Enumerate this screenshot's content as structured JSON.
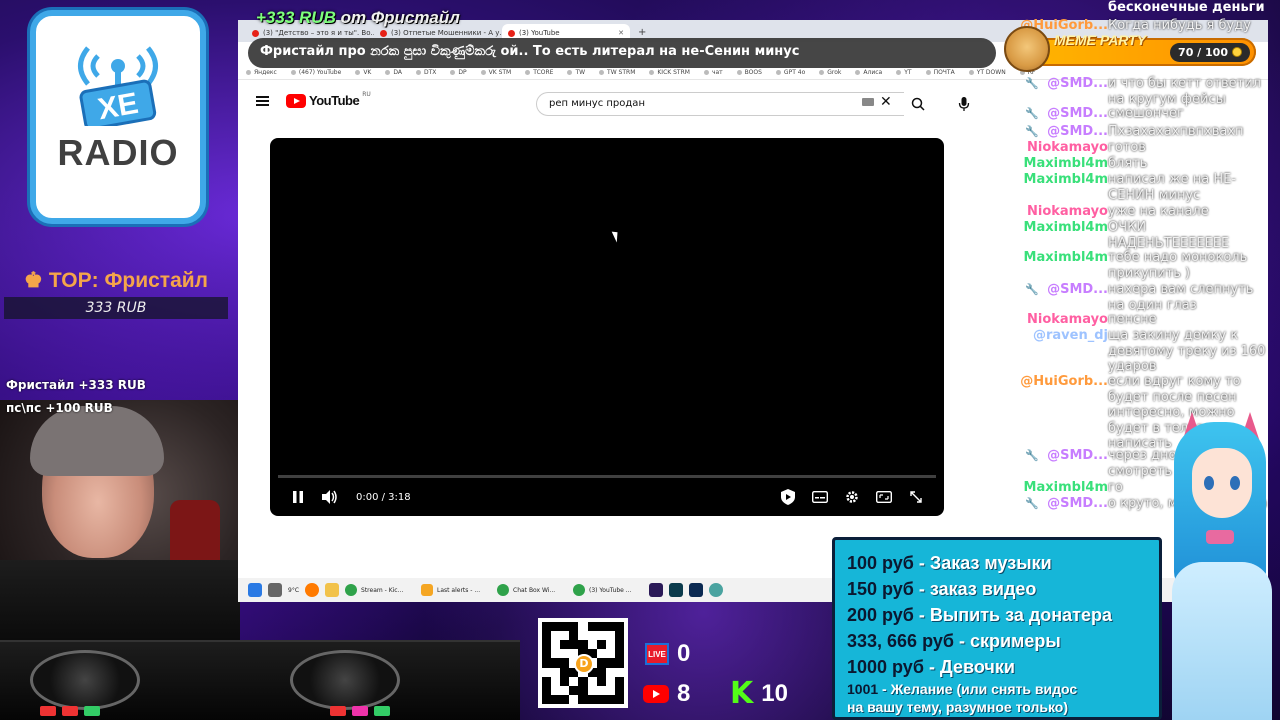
{
  "donation_alert": {
    "amount": "+333 RUB",
    "from_label": "от Фристайл"
  },
  "ticker_text": "Фристайл про නරක පුසා විකුණුම්කරු ой.. То есть литерал на не-Сенин минус",
  "meme_party": {
    "title": "MEME PARTY",
    "count": "70 / 100"
  },
  "logo": {
    "badge": "XE",
    "text": "RADIO"
  },
  "top_donor": {
    "title": "TOP: Фристайл",
    "amount": "333 RUB"
  },
  "donate_feed": [
    "Фристайл +333 RUB",
    "пс\\пс +100 RUB"
  ],
  "browser": {
    "tabs": [
      {
        "label": "(3) \"Детство – это я и ты\". Во..."
      },
      {
        "label": "(3) Отпетые Мошенники - А у..."
      },
      {
        "label": "(3) YouTube"
      }
    ],
    "bookmarks": [
      "Яндекс",
      "(467) YouTube",
      "VK",
      "DA",
      "DTX",
      "DP",
      "VK STM",
      "TCORE",
      "TW",
      "TW STRM",
      "KICK STRM",
      "чат",
      "BOOS",
      "GPT 4o",
      "Grok",
      "Алиса",
      "YT",
      "ПОЧТА",
      "YT DOWN",
      "RF"
    ],
    "youtube": {
      "logo_text": "YouTube",
      "region": "RU",
      "search_value": "реп минус продан",
      "player": {
        "time": "0:00 / 3:18",
        "progress": 0.0
      }
    },
    "taskbar": [
      {
        "label": "Stream - Kic..."
      },
      {
        "label": "Last alerts - ..."
      },
      {
        "label": "Chat Box Wi..."
      },
      {
        "label": "(3) YouTube ..."
      }
    ],
    "weather": "9°C"
  },
  "chat": {
    "header": "бесконечные деньги",
    "messages": [
      {
        "user": "@HuiGorb...",
        "color": "#ff9a3c",
        "mod": false,
        "text": "Когда нибудь я буду"
      },
      {
        "user": "@SMD...",
        "color": "#c77dff",
        "mod": true,
        "text": "и что бы кетт ответил на кругум фейсы"
      },
      {
        "user": "@SMD...",
        "color": "#c77dff",
        "mod": true,
        "text": "смешончег"
      },
      {
        "user": "@SMD...",
        "color": "#c77dff",
        "mod": true,
        "text": "Пхзахахахпвпхвахп"
      },
      {
        "user": "Niokamayo",
        "color": "#ff5fa2",
        "mod": false,
        "text": "готов"
      },
      {
        "user": "Maximbl4m",
        "color": "#39e07a",
        "mod": false,
        "text": "блять"
      },
      {
        "user": "Maximbl4m",
        "color": "#39e07a",
        "mod": false,
        "text": "написал же на НЕ-СЕНИН минус"
      },
      {
        "user": "Niokamayo",
        "color": "#ff5fa2",
        "mod": false,
        "text": "уже на канале"
      },
      {
        "user": "Maximbl4m",
        "color": "#39e07a",
        "mod": false,
        "text": "ОЧКИ НАДЕНЬТЕЕЕЕЕЕЕ"
      },
      {
        "user": "Maximbl4m",
        "color": "#39e07a",
        "mod": false,
        "text": "тебе надо моноколь прикупить )"
      },
      {
        "user": "@SMD...",
        "color": "#c77dff",
        "mod": true,
        "text": "нахера вам слепнуть на один глаз"
      },
      {
        "user": "Niokamayo",
        "color": "#ff5fa2",
        "mod": false,
        "text": "пенсне"
      },
      {
        "user": "@raven_dj",
        "color": "#9ec3ff",
        "mod": false,
        "text": "ща закину демку к девятому треку из 160 ударов"
      },
      {
        "user": "@HuiGorb...",
        "color": "#ff9a3c",
        "mod": false,
        "text": "если вдруг кому то будет после песен интересно, можно будет в телеге написать"
      },
      {
        "user": "@SMD...",
        "color": "#c77dff",
        "mod": true,
        "text": "через днопотом смотреть"
      },
      {
        "user": "Maximbl4m",
        "color": "#39e07a",
        "mod": false,
        "text": "го"
      },
      {
        "user": "@SMD...",
        "color": "#c77dff",
        "mod": true,
        "text": "о круто, мб повлиял на"
      }
    ]
  },
  "price_list": [
    {
      "price": "100 руб",
      "item": " - Заказ музыки"
    },
    {
      "price": "150 руб",
      "item": " - заказ видео"
    },
    {
      "price": "200 руб",
      "item": " - Выпить за донатера"
    },
    {
      "price": "333, 666 руб",
      "item": " - скримеры"
    },
    {
      "price": "1000 руб",
      "item": " - Девочки"
    },
    {
      "price": "1001",
      "item": " - Желание (или снять видос"
    },
    {
      "price": "",
      "item": "на вашу тему, разумное только)"
    }
  ],
  "stats": {
    "live": "0",
    "youtube": "8",
    "kick": "10",
    "live_label": "LIVE"
  }
}
